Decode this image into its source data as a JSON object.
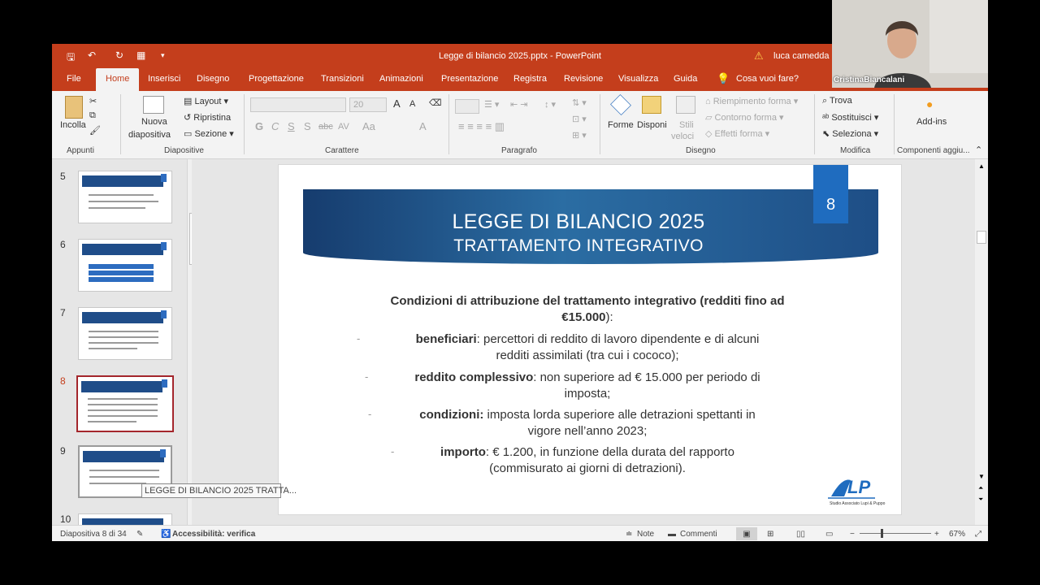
{
  "window": {
    "title": "Legge di bilancio 2025.pptx  -  PowerPoint",
    "user": "luca camedda"
  },
  "tabs": [
    "File",
    "Home",
    "Inserisci",
    "Disegno",
    "Progettazione",
    "Transizioni",
    "Animazioni",
    "Presentazione",
    "Registra",
    "Revisione",
    "Visualizza",
    "Guida"
  ],
  "tell_me": "Cosa vuoi fare?",
  "ribbon": {
    "clipboard": {
      "paste": "Incolla",
      "group": "Appunti"
    },
    "slides": {
      "new_slide_1": "Nuova",
      "new_slide_2": "diapositiva",
      "layout": "Layout",
      "reset": "Ripristina",
      "section": "Sezione",
      "group": "Diapositive"
    },
    "font": {
      "size": "20",
      "bold": "G",
      "italic": "C",
      "underline": "S",
      "shadow": "S",
      "strike": "abc",
      "spacing": "AV",
      "case": "Aa",
      "color": "A",
      "grow": "A",
      "shrink": "A",
      "group": "Carattere"
    },
    "paragraph": {
      "group": "Paragrafo"
    },
    "drawing": {
      "shapes": "Forme",
      "arrange": "Disponi",
      "styles_1": "Stili",
      "styles_2": "veloci",
      "fill": "Riempimento forma",
      "outline": "Contorno forma",
      "effects": "Effetti forma",
      "group": "Disegno"
    },
    "editing": {
      "find": "Trova",
      "replace": "Sostituisci",
      "select": "Seleziona",
      "group": "Modifica"
    },
    "addins": {
      "label": "Add-ins",
      "group": "Componenti aggiu..."
    }
  },
  "thumbnails": [
    {
      "num": "5",
      "title": "LEGGE DI BILANCIO 2025"
    },
    {
      "num": "6",
      "title": "LEGGE DI BILANCIO 2025"
    },
    {
      "num": "7",
      "title": "LEGGE DI BILANCIO 2025"
    },
    {
      "num": "8",
      "title": "LEGGE DI BILANCIO 2025",
      "selected": true
    },
    {
      "num": "9",
      "title": "LEGGE DI BILANCIO 2025"
    },
    {
      "num": "10",
      "title": ""
    }
  ],
  "tooltip": "LEGGE DI BILANCIO 2025 TRATTA...",
  "slide": {
    "number": "8",
    "title1": "LEGGE DI BILANCIO 2025",
    "title2": "TRATTAMENTO INTEGRATIVO",
    "heading_1": "Condizioni di attribuzione del trattamento integrativo (redditi fino ad",
    "heading_2": "€15.000",
    "heading_2_end": "):",
    "bullets": [
      {
        "bold": "beneficiari",
        "text": ": percettori di reddito di lavoro dipendente e di alcuni",
        "text2": "redditi assimilati (tra cui i cococo);"
      },
      {
        "bold": "reddito complessivo",
        "text": ": non superiore ad € 15.000 per periodo di",
        "text2": "imposta;"
      },
      {
        "bold": "condizioni:",
        "text": " imposta lorda superiore alle detrazioni spettanti in",
        "text2": "vigore nell’anno 2023;"
      },
      {
        "bold": "importo",
        "text": ": € 1.200, in funzione della durata del rapporto",
        "text2": "(commisurato ai giorni di detrazioni)."
      }
    ],
    "logo_caption": "Studio Associato Lupi & Puppo"
  },
  "statusbar": {
    "slide_info": "Diapositiva 8 di 34",
    "accessibility": "Accessibilità: verifica",
    "notes": "Note",
    "comments": "Commenti",
    "zoom": "67%"
  },
  "webcam": {
    "name": "CristinaBiancalani"
  }
}
